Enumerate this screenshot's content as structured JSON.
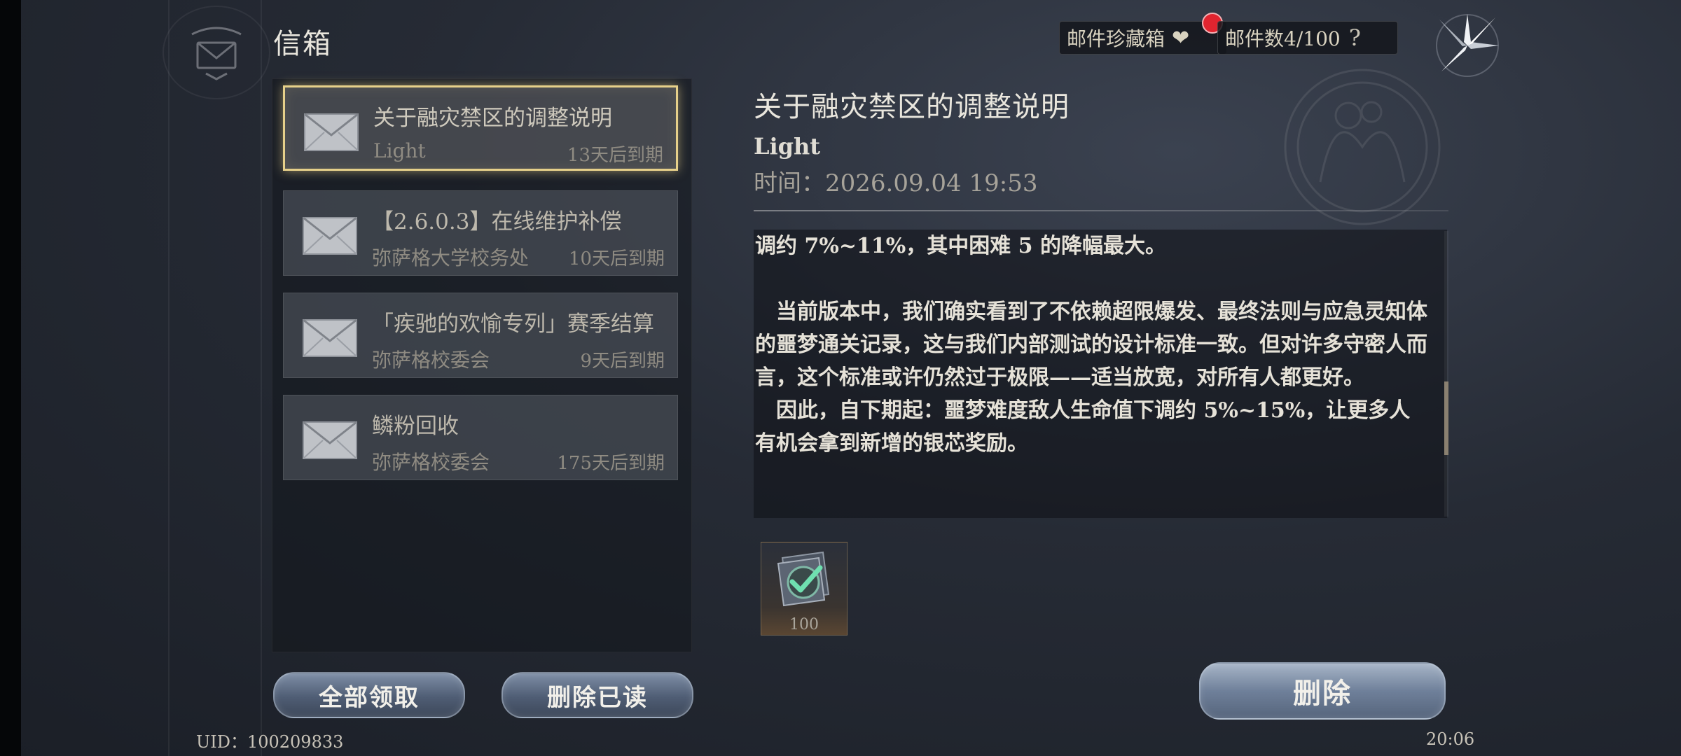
{
  "header": {
    "title": "信箱",
    "favorites_label": "邮件珍藏箱",
    "mail_count_label": "邮件数4/100",
    "help_symbol": "?"
  },
  "mail_list": [
    {
      "subject": "关于融灾禁区的调整说明",
      "sender": "Light",
      "expire": "13天后到期",
      "selected": true
    },
    {
      "subject": "【2.6.0.3】在线维护补偿",
      "sender": "弥萨格大学校务处",
      "expire": "10天后到期",
      "selected": false
    },
    {
      "subject": "「疾驰的欢愉专列」赛季结算",
      "sender": "弥萨格校委会",
      "expire": "9天后到期",
      "selected": false
    },
    {
      "subject": "鳞粉回收",
      "sender": "弥萨格校委会",
      "expire": "175天后到期",
      "selected": false
    }
  ],
  "detail": {
    "title": "关于融灾禁区的调整说明",
    "sender": "Light",
    "time": "时间：2026.09.04 19:53",
    "paragraphs": [
      "调约 7%~11%，其中困难 5 的降幅最大。",
      "",
      "　当前版本中，我们确实看到了不依赖超限爆发、最终法则与应急灵知体的噩梦通关记录，这与我们内部测试的设计标准一致。但对许多守密人而言，这个标准或许仍然过于极限——适当放宽，对所有人都更好。",
      "　因此，自下期起：噩梦难度敌人生命值下调约 5%~15%，让更多人有机会拿到新增的银芯奖励。"
    ],
    "reward_qty": "100"
  },
  "buttons": {
    "claim_all": "全部领取",
    "delete_read": "删除已读",
    "delete": "删除"
  },
  "footer": {
    "uid": "UID：100209833",
    "clock": "20:06"
  },
  "colors": {
    "selected_border": "#e6d08a",
    "badge": "#e1242f"
  }
}
